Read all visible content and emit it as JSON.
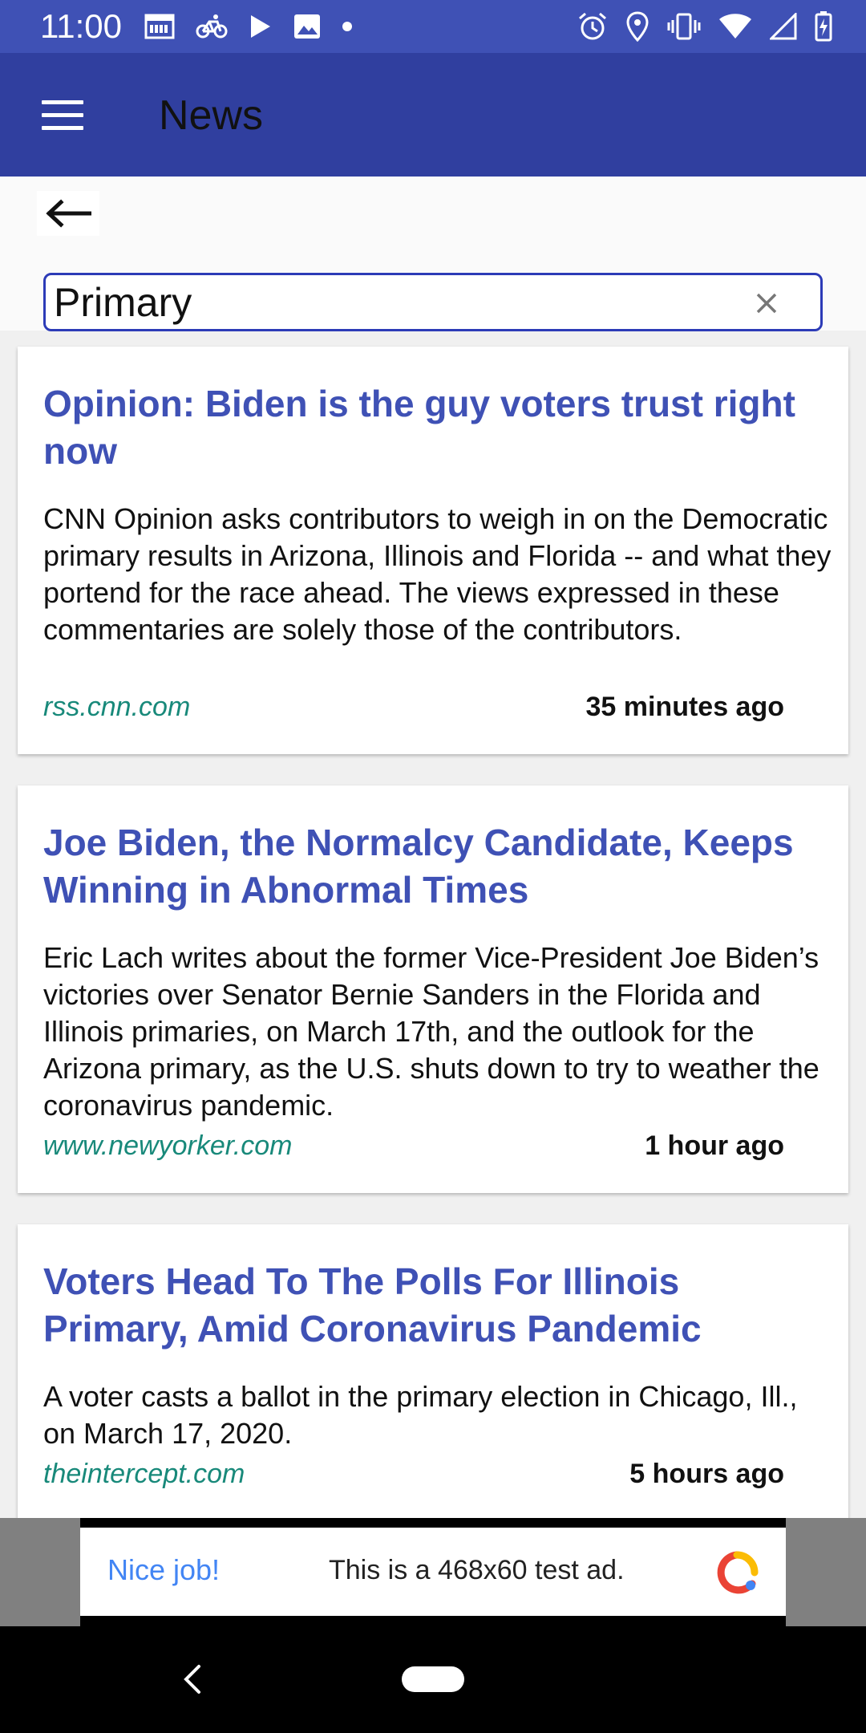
{
  "status_bar": {
    "time": "11:00",
    "left_icons": [
      "calendar-icon",
      "bike-icon",
      "play-store-icon",
      "image-icon",
      "dot-icon"
    ],
    "right_icons": [
      "alarm-icon",
      "location-icon",
      "vibrate-icon",
      "wifi-icon",
      "signal-icon",
      "battery-charging-icon"
    ]
  },
  "app_bar": {
    "title": "News",
    "menu_icon": "hamburger-menu-icon"
  },
  "back_icon": "arrow-left-icon",
  "search": {
    "value": "Primary",
    "clear_icon": "close-icon"
  },
  "articles": [
    {
      "title": "Opinion: Biden is the guy voters trust right now",
      "description": "CNN Opinion asks contributors to weigh in on the Democratic primary results in Arizona, Illinois and Florida -- and what they portend for the race ahead. The views expressed in these commentaries are solely those of the contributors.",
      "source": "rss.cnn.com",
      "time": "35 minutes ago"
    },
    {
      "title": "Joe Biden, the Normalcy Candidate, Keeps Winning in Abnormal Times",
      "description": "Eric Lach writes about the former Vice-President Joe Biden’s victories over Senator Bernie Sanders in the Florida and Illinois primaries, on March 17th, and the outlook for the Arizona primary, as the U.S. shuts down to try to weather the coronavirus pandemic.",
      "source": "www.newyorker.com",
      "time": "1 hour ago"
    },
    {
      "title": "Voters Head To The Polls For Illinois Primary, Amid Coronavirus Pandemic",
      "description": "A voter casts a ballot in the primary election in Chicago, Ill., on March 17, 2020.",
      "source": "theintercept.com",
      "time": "5 hours ago"
    }
  ],
  "ad": {
    "headline": "Nice job!",
    "text": "This is a 468x60 test ad.",
    "logo_icon": "admob-logo-icon"
  },
  "nav_bar": {
    "back_icon": "nav-back-icon",
    "home_icon": "nav-home-pill-icon"
  },
  "colors": {
    "status_bar": "#3f51b5",
    "app_bar": "#303f9f",
    "title_accent": "#3f51b5",
    "source_link": "#18897a",
    "search_border": "#2c3bb7",
    "ad_headline": "#4285f4"
  }
}
